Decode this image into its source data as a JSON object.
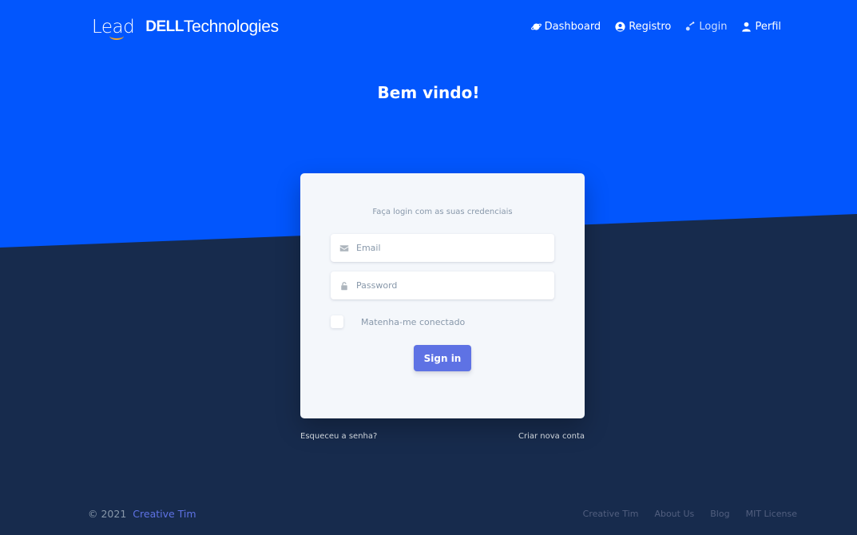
{
  "brand": {
    "lead": "Lead",
    "dell": "DELL",
    "technologies": "Technologies"
  },
  "nav": {
    "items": [
      {
        "label": "Dashboard",
        "icon": "planet-icon"
      },
      {
        "label": "Registro",
        "icon": "user-circle-icon"
      },
      {
        "label": "Login",
        "icon": "key-icon"
      },
      {
        "label": "Perfil",
        "icon": "user-icon"
      }
    ]
  },
  "welcome": "Bem vindo!",
  "login_card": {
    "subtitle": "Faça login com as suas credenciais",
    "email_placeholder": "Email",
    "email_value": "",
    "password_placeholder": "Password",
    "password_value": "",
    "remember_label": "Matenha-me conectado",
    "remember_checked": false,
    "sign_in_label": "Sign in"
  },
  "links": {
    "forgot": "Esqueceu a senha?",
    "create": "Criar nova conta"
  },
  "footer": {
    "copyright": "© 2021",
    "brand": "Creative Tim",
    "links": [
      "Creative Tim",
      "About Us",
      "Blog",
      "MIT License"
    ]
  },
  "colors": {
    "primary_blue": "#0256fd",
    "dark_navy": "#172b4d",
    "button": "#5e72e4"
  }
}
